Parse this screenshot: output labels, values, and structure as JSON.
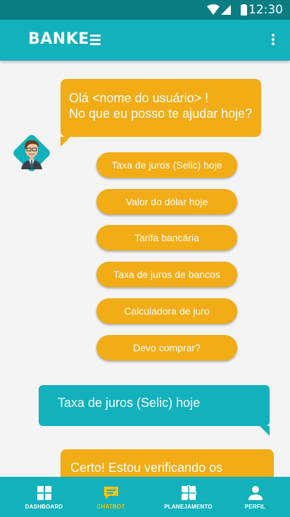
{
  "status_bar": {
    "time": "12:30",
    "icons": [
      "wifi-icon",
      "signal-icon",
      "battery-icon"
    ]
  },
  "app_bar": {
    "logo_text": "BANKE",
    "menu_icon": "more-vert-icon"
  },
  "chat": {
    "bot_greeting_line1": "Olá <nome do usuário> !",
    "bot_greeting_line2": "No que eu posso te ajudar hoje?",
    "options": [
      "Taxa de juros (Selic) hoje",
      "Valor do dólar hoje",
      "Tarifa bancária",
      "Taxa de juros de bancos",
      "Calculadora de juro",
      "Devo comprar?"
    ],
    "user_message": "Taxa de juros (Selic) hoje",
    "bot_reply": "Certo! Estou verificando os"
  },
  "bottom_nav": {
    "items": [
      {
        "label": "DASHBOARD",
        "icon": "dashboard-icon"
      },
      {
        "label": "CHATBOT",
        "icon": "chat-icon"
      },
      {
        "label": "PLANEJAMENTO",
        "icon": "puzzle-icon"
      },
      {
        "label": "PERFIL",
        "icon": "person-icon"
      }
    ],
    "active_index": 1
  },
  "colors": {
    "primary": "#12b1bb",
    "primary_dark": "#0a7d83",
    "accent": "#f1ac16",
    "active_label": "#f1c40f",
    "background": "#f4f4f4"
  }
}
